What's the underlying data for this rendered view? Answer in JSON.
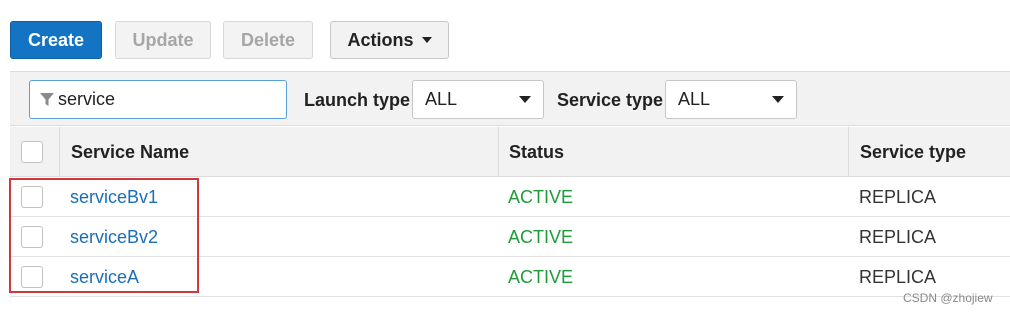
{
  "toolbar": {
    "create_label": "Create",
    "update_label": "Update",
    "delete_label": "Delete",
    "actions_label": "Actions"
  },
  "filter": {
    "search_value": "service",
    "launch_type_label": "Launch type",
    "launch_type_value": "ALL",
    "service_type_label": "Service type",
    "service_type_value": "ALL"
  },
  "table": {
    "columns": [
      "Service Name",
      "Status",
      "Service type"
    ],
    "rows": [
      {
        "name": "serviceBv1",
        "status": "ACTIVE",
        "type": "REPLICA"
      },
      {
        "name": "serviceBv2",
        "status": "ACTIVE",
        "type": "REPLICA"
      },
      {
        "name": "serviceA",
        "status": "ACTIVE",
        "type": "REPLICA"
      }
    ]
  },
  "watermark": "CSDN @zhojiew",
  "colors": {
    "primary": "#1474c4",
    "link": "#1a6fb8",
    "active": "#1e9c3a",
    "highlight": "#d0383f"
  },
  "icons": {
    "search": "filter-funnel-icon",
    "dropdown": "chevron-down-icon"
  }
}
